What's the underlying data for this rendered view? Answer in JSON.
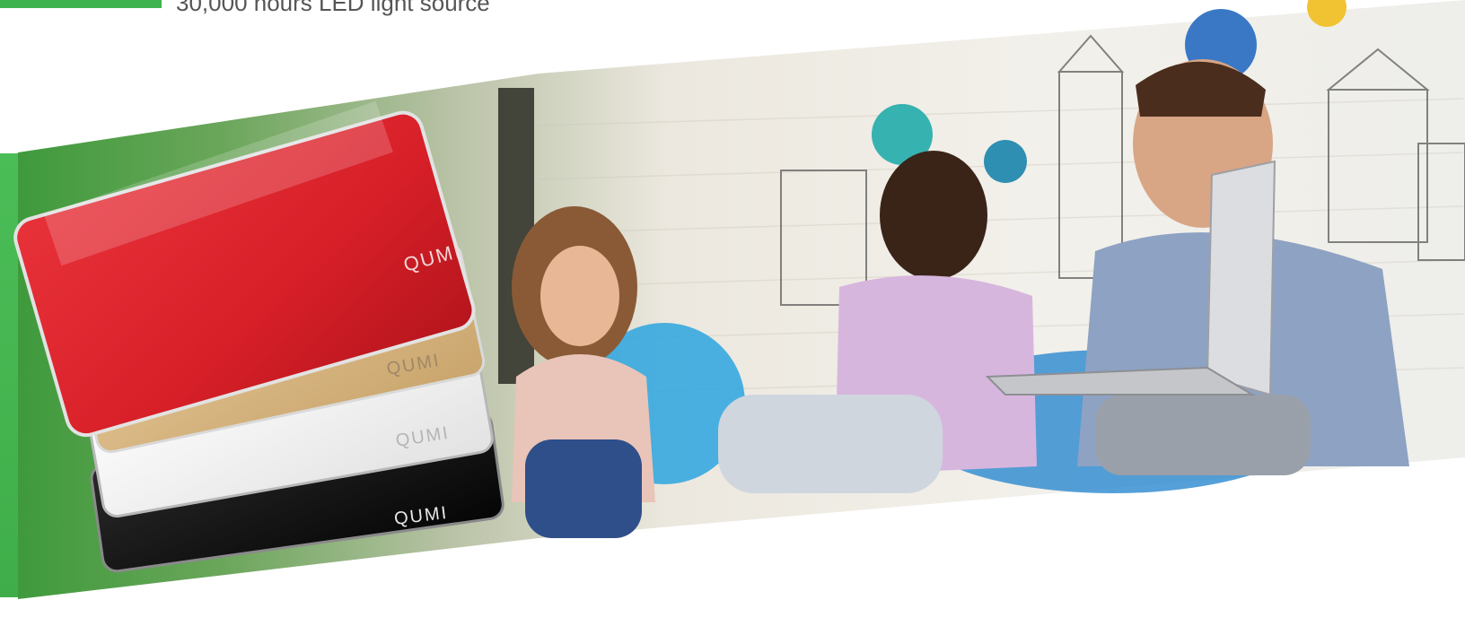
{
  "header": {
    "feature_text": "30,000 hours LED light source"
  },
  "projectors": [
    {
      "color_name": "red",
      "logo": "QUMI"
    },
    {
      "color_name": "gold",
      "logo": "QUMI"
    },
    {
      "color_name": "white",
      "logo": "QUMI"
    },
    {
      "color_name": "black",
      "logo": "QUMI"
    }
  ],
  "colors": {
    "accent_green": "#3fb34f",
    "red": "#d9212b",
    "gold": "#d8b57e",
    "white": "#f4f4f4",
    "black": "#0f0f0f"
  }
}
